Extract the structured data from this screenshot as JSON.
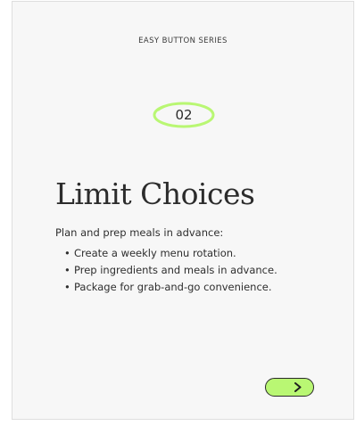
{
  "card": {
    "series_label": "EASY BUTTON SERIES",
    "step_number": "02",
    "title": "Limit Choices",
    "intro": "Plan and prep meals in advance:",
    "bullets": [
      "Create a weekly menu rotation.",
      "Prep ingredients and meals in advance.",
      "Package for grab-and-go convenience."
    ],
    "next_icon": "chevron-right-icon"
  },
  "colors": {
    "accent": "#b9f773",
    "card_background": "#f7f7f7",
    "text": "#2c2c2c"
  }
}
